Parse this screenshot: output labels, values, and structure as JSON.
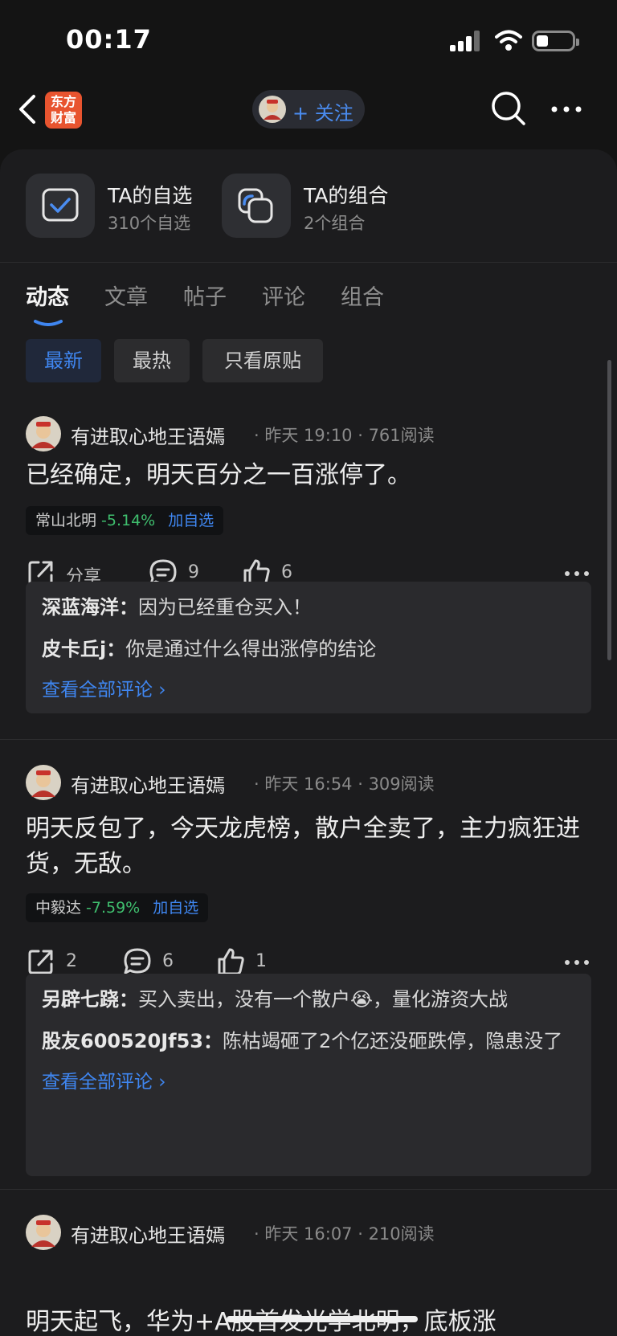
{
  "status_bar": {
    "time": "00:17"
  },
  "nav": {
    "logo_text": "东方\n财富",
    "follow_label": "+ 关注"
  },
  "quick_links": [
    {
      "title": "TA的自选",
      "subtitle": "310个自选"
    },
    {
      "title": "TA的组合",
      "subtitle": "2个组合"
    }
  ],
  "tabs": [
    "动态",
    "文章",
    "帖子",
    "评论",
    "组合"
  ],
  "active_tab": "动态",
  "filters": [
    "最新",
    "最热",
    "只看原贴"
  ],
  "posts": [
    {
      "author": "有进取心地王语嫣",
      "meta": "· 昨天 19:10 · 761阅读",
      "content": "已经确定，明天百分之一百涨停了。",
      "stock": {
        "name": "常山北明",
        "change": "-5.14%",
        "add_label": "加自选"
      },
      "share_label": "分享",
      "comment_count": "9",
      "like_count": "6",
      "comments": [
        {
          "user": "深蓝海洋：",
          "text": "因为已经重仓买入！"
        },
        {
          "user": "皮卡丘j：",
          "text": "你是通过什么得出涨停的结论"
        }
      ],
      "view_all": "查看全部评论 ›"
    },
    {
      "author": "有进取心地王语嫣",
      "meta": "· 昨天 16:54 · 309阅读",
      "content": "明天反包了，今天龙虎榜，散户全卖了，主力疯狂进货，无敌。",
      "stock": {
        "name": "中毅达",
        "change": "-7.59%",
        "add_label": "加自选"
      },
      "share_label": "2",
      "comment_count": "6",
      "like_count": "1",
      "comments": [
        {
          "user": "另辟七跷：",
          "text": "买入卖出，没有一个散户😭，量化游资大战"
        },
        {
          "user": "股友600520Jf53：",
          "text": "陈枯竭砸了2个亿还没砸跌停，隐患没了"
        }
      ],
      "view_all": "查看全部评论 ›"
    },
    {
      "author": "有进取心地王语嫣",
      "meta": "· 昨天 16:07 · 210阅读",
      "content": "明天起飞，华为+A股首发光学北明，底板涨"
    }
  ],
  "colors": {
    "accent": "#3f86f0",
    "down": "#3fbf6e",
    "logo": "#e8542f"
  }
}
